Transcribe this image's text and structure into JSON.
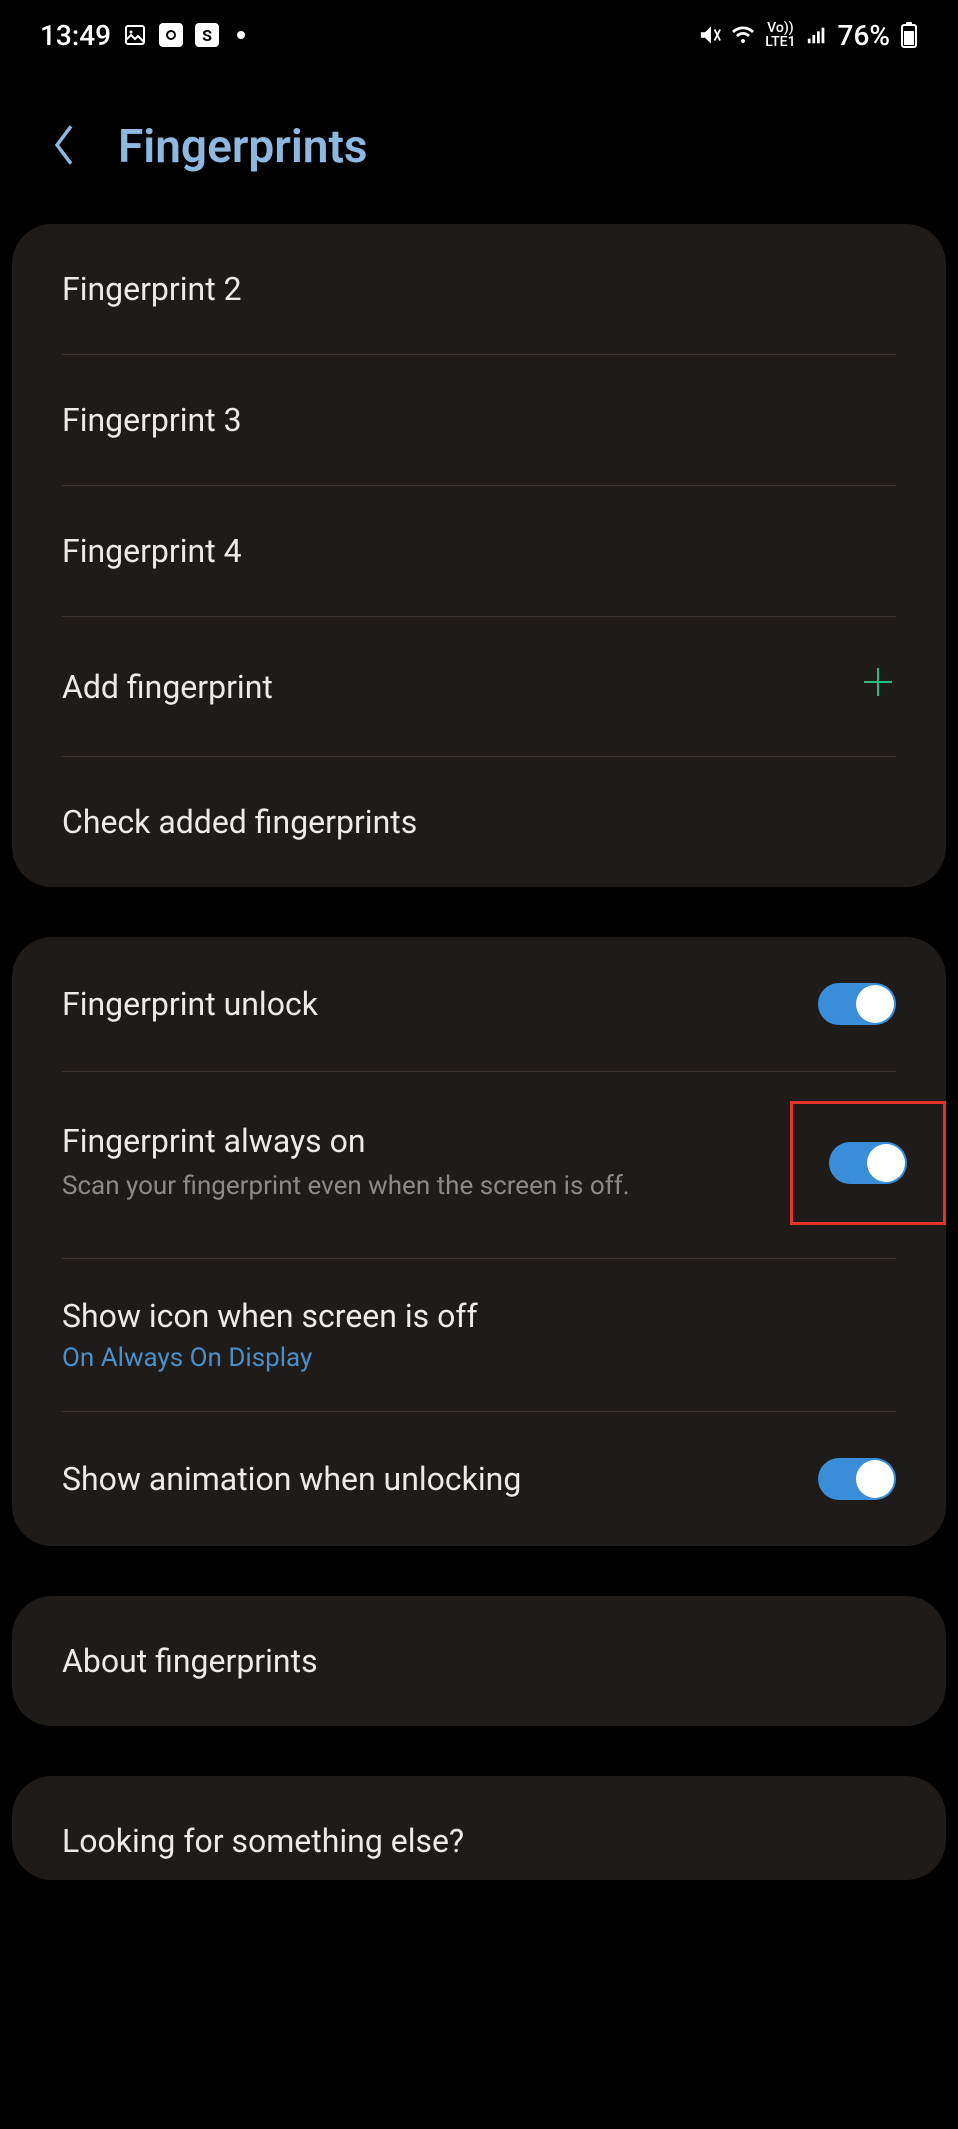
{
  "statusBar": {
    "time": "13:49",
    "battery": "76%",
    "lte": "Vo))\nLTE1"
  },
  "header": {
    "title": "Fingerprints"
  },
  "section1": {
    "items": [
      {
        "label": "Fingerprint 2"
      },
      {
        "label": "Fingerprint 3"
      },
      {
        "label": "Fingerprint 4"
      },
      {
        "label": "Add fingerprint"
      },
      {
        "label": "Check added fingerprints"
      }
    ]
  },
  "section2": {
    "fingerprintUnlock": {
      "title": "Fingerprint unlock",
      "enabled": true
    },
    "fingerprintAlwaysOn": {
      "title": "Fingerprint always on",
      "subtitle": "Scan your fingerprint even when the screen is off.",
      "enabled": true,
      "highlighted": true
    },
    "showIcon": {
      "title": "Show icon when screen is off",
      "subtitle": "On Always On Display"
    },
    "showAnimation": {
      "title": "Show animation when unlocking",
      "enabled": true
    }
  },
  "section3": {
    "about": {
      "title": "About fingerprints"
    }
  },
  "section4": {
    "looking": {
      "title": "Looking for something else?"
    }
  }
}
